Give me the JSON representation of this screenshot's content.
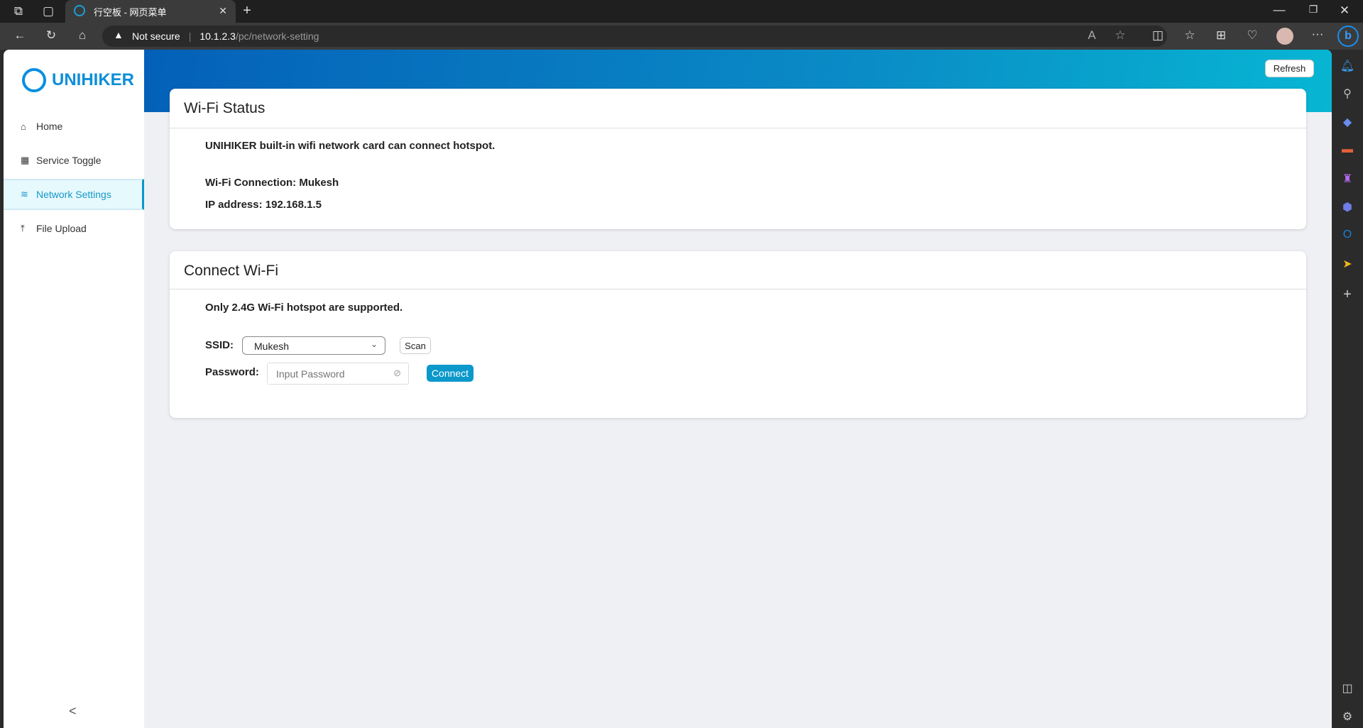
{
  "browser": {
    "tab_title": "行空板 - 网页菜单",
    "security": "Not secure",
    "url_host": "10.1.2.3",
    "url_path": "/pc/network-setting"
  },
  "sidebar": {
    "logo": "UNIHIKER",
    "items": [
      {
        "label": "Home"
      },
      {
        "label": "Service Toggle"
      },
      {
        "label": "Network Settings"
      },
      {
        "label": "File Upload"
      }
    ],
    "collapse": "<"
  },
  "header": {
    "refresh": "Refresh"
  },
  "wifi_status": {
    "title": "Wi-Fi Status",
    "desc": "UNIHIKER built-in wifi network card can connect hotspot.",
    "connection": "Wi-Fi Connection: Mukesh",
    "ip": "IP address: 192.168.1.5"
  },
  "connect": {
    "title": "Connect Wi-Fi",
    "note": "Only 2.4G Wi-Fi hotspot are supported.",
    "ssid_label": "SSID:",
    "ssid_value": "Mukesh",
    "scan": "Scan",
    "password_label": "Password:",
    "password_placeholder": "Input Password",
    "connect": "Connect"
  },
  "colors": {
    "accent": "#0b98cb"
  }
}
